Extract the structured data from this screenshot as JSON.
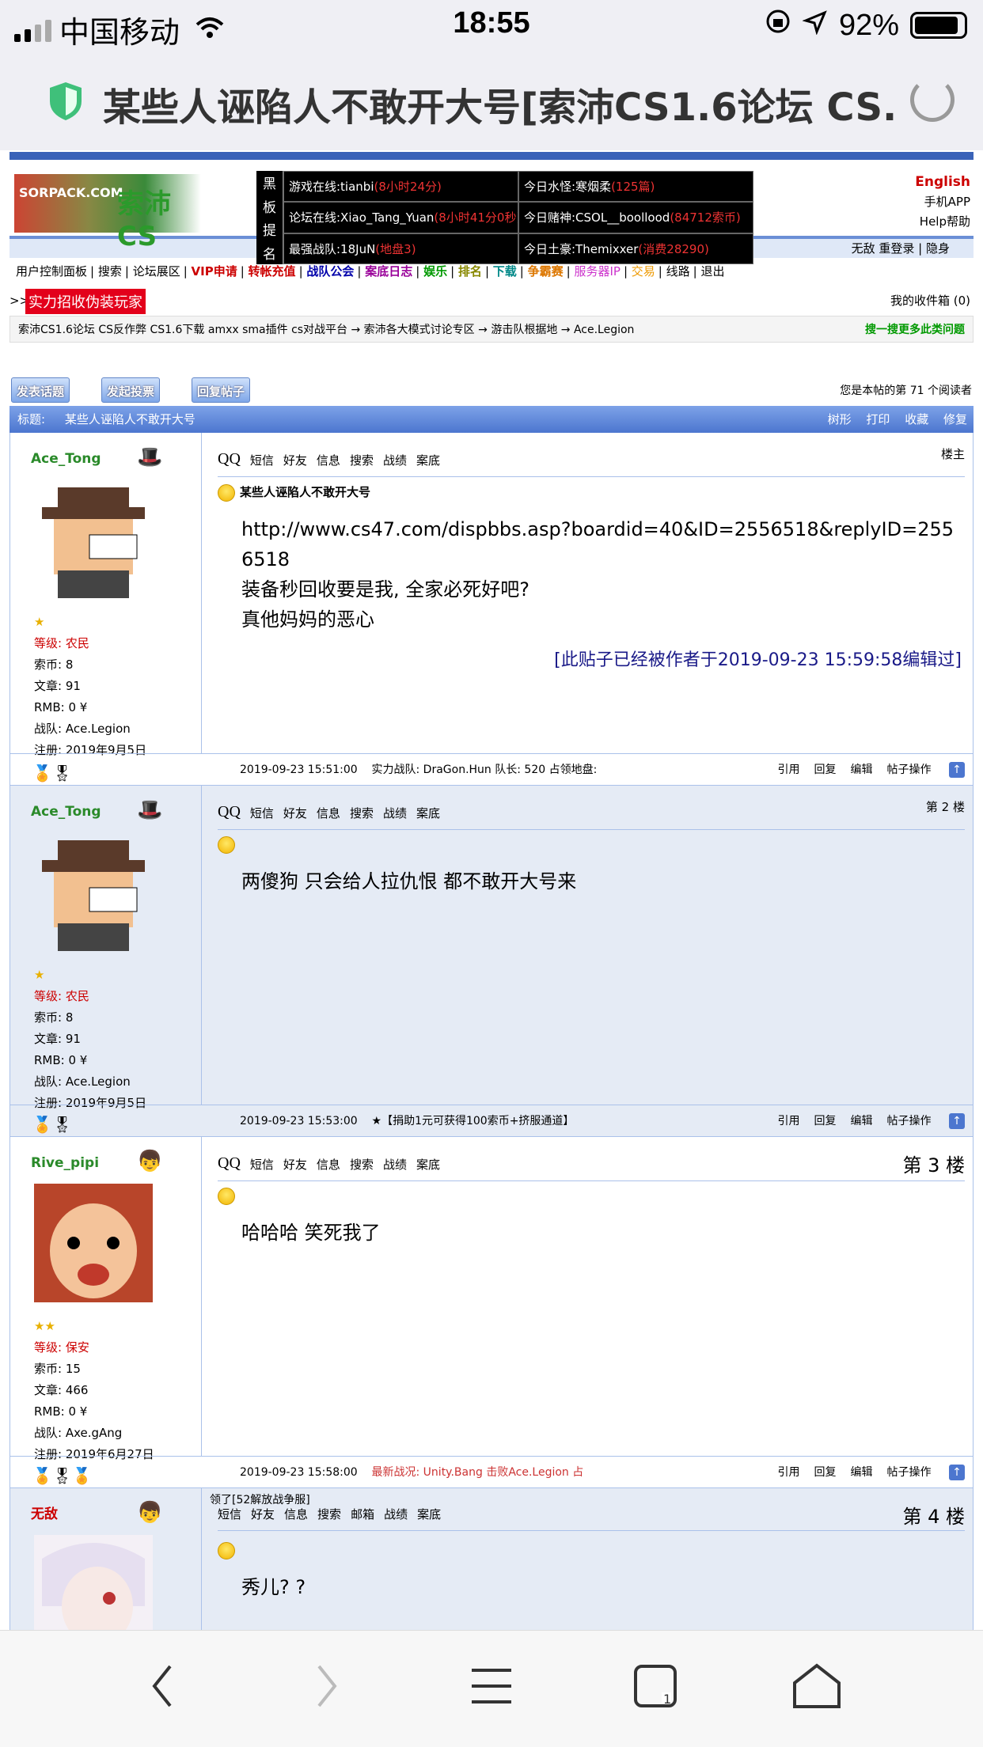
{
  "status": {
    "carrier": "中国移动",
    "time": "18:55",
    "battery": "92%"
  },
  "browser": {
    "title": "某些人诬陷人不敢开大号[索沛CS1.6论坛 CS..."
  },
  "board": {
    "label": [
      "黑",
      "板",
      "提",
      "名"
    ],
    "cells": [
      {
        "text": "游戏在线:tianbi",
        "red": "(8小时24分)"
      },
      {
        "text": "今日水怪:寒烟柔",
        "red": "(125篇)"
      },
      {
        "text": "论坛在线:Xiao_Tang_Yuan",
        "red": "(8小时41分0秒)"
      },
      {
        "text": "今日赌神:CSOL__boollood",
        "red": "(84712索币)"
      },
      {
        "text": "最强战队:18JuN",
        "red": "(地盘3)"
      },
      {
        "text": "今日土豪:Themixxer",
        "red": "(消费28290)"
      }
    ]
  },
  "header": {
    "logo": "SORPACK.COM",
    "logo_cs": "索沛CS",
    "english": "English",
    "app": "手机APP",
    "help": "Help帮助",
    "login": "无敌 重登录 | 隐身"
  },
  "nav": [
    "用户控制面板",
    "搜索",
    "论坛展区",
    "VIP申请",
    "转帐充值",
    "战队公会",
    "案底日志",
    "娱乐",
    "排名",
    "下载",
    "争霸赛",
    "服务器IP",
    "交易",
    "线路",
    "退出"
  ],
  "recruit": {
    "prefix": ">>",
    "text": "实力招收伪装玩家",
    "inbox": "我的收件箱 (0)"
  },
  "breadcrumb": {
    "path": "索沛CS1.6论坛 CS反作弊 CS1.6下载 amxx sma插件 cs对战平台 → 索沛各大模式讨论专区 → 游击队根据地 → Ace.Legion",
    "more": "搜一搜更多此类问题"
  },
  "actions": {
    "new": "发表话题",
    "poll": "发起投票",
    "reply": "回复帖子",
    "reader": "您是本帖的第 71 个阅读者"
  },
  "thread": {
    "label": "标题:",
    "title": "某些人诬陷人不敢开大号",
    "tools": [
      "树形",
      "打印",
      "收藏",
      "修复"
    ]
  },
  "toolbar": {
    "qq": "QQ",
    "sms": "短信",
    "friend": "好友",
    "info": "信息",
    "search": "搜索",
    "record": "战绩",
    "case": "案底",
    "mail": "邮箱"
  },
  "footer_ops": [
    "引用",
    "回复",
    "编辑",
    "帖子操作"
  ],
  "posts": [
    {
      "user": "Ace_Tong",
      "level": "等级: 农民",
      "coins": "索币: 8",
      "articles": "文章: 91",
      "rmb": "RMB: 0 ¥",
      "team": "战队: Ace.Legion",
      "reg": "注册: 2019年9月5日",
      "floor": "楼主",
      "title": "某些人诬陷人不敢开大号",
      "body": [
        "http://www.cs47.com/dispbbs.asp?boardid=40&ID=2556518&replyID=2556518",
        "装备秒回收要是我, 全家必死好吧?",
        "真他妈妈的恶心"
      ],
      "edit": "[此贴子已经被作者于2019-09-23 15:59:58编辑过]",
      "date": "2019-09-23 15:51:00",
      "foot": "实力战队: DraGon.Hun 队长: 520 占领地盘:"
    },
    {
      "user": "Ace_Tong",
      "level": "等级: 农民",
      "coins": "索币: 8",
      "articles": "文章: 91",
      "rmb": "RMB: 0 ¥",
      "team": "战队: Ace.Legion",
      "reg": "注册: 2019年9月5日",
      "floor": "第 2 楼",
      "body": [
        "两傻狗  只会给人拉仇恨  都不敢开大号来"
      ],
      "date": "2019-09-23 15:53:00",
      "foot": "★【捐助1元可获得100索币+挤服通道】"
    },
    {
      "user": "Rive_pipi",
      "level": "等级: 保安",
      "coins": "索币: 15",
      "articles": "文章: 466",
      "rmb": "RMB: 0 ¥",
      "team": "战队: Axe.gAng",
      "reg": "注册: 2019年6月27日",
      "floor": "第 3 楼",
      "body": [
        "哈哈哈 笑死我了"
      ],
      "date": "2019-09-23 15:58:00",
      "foot": "最新战况: Unity.Bang 击败Ace.Legion 占"
    },
    {
      "user": "无敌",
      "floor": "第 4 楼",
      "extra": "领了[52解放战争服]",
      "body": [
        "秀儿? ?"
      ]
    }
  ]
}
